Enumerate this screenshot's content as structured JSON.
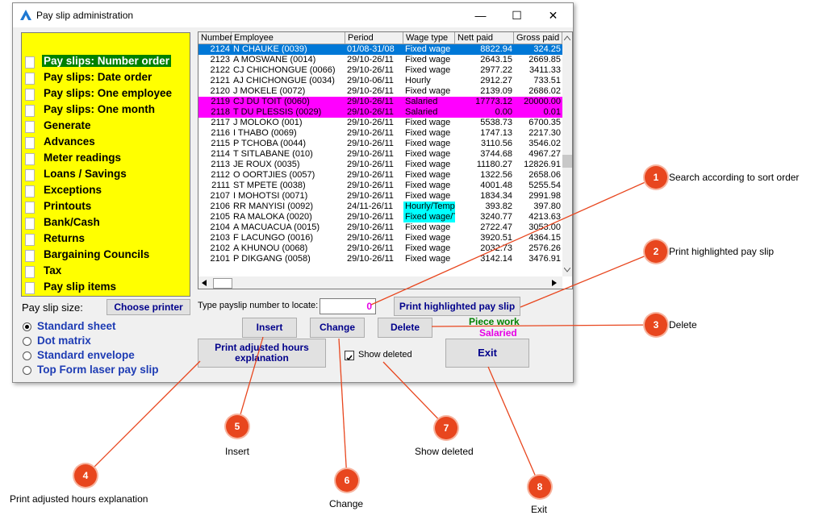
{
  "window": {
    "title": "Pay slip administration",
    "minimize": "—",
    "maximize": "☐",
    "close": "✕"
  },
  "sidebar": {
    "items": [
      {
        "label": "Pay slips: Number order",
        "selected": true
      },
      {
        "label": "Pay slips: Date order"
      },
      {
        "label": "Pay slips: One employee"
      },
      {
        "label": "Pay slips: One month"
      },
      {
        "label": "Generate"
      },
      {
        "label": "Advances"
      },
      {
        "label": "Meter readings"
      },
      {
        "label": "Loans / Savings"
      },
      {
        "label": "Exceptions"
      },
      {
        "label": "Printouts"
      },
      {
        "label": "Bank/Cash"
      },
      {
        "label": "Returns"
      },
      {
        "label": "Bargaining Councils"
      },
      {
        "label": "Tax"
      },
      {
        "label": "Pay slip items"
      }
    ]
  },
  "table": {
    "headers": [
      "Number",
      "Employee",
      "Period",
      "Wage type",
      "Nett paid",
      "Gross paid"
    ],
    "rows": [
      {
        "number": "2124",
        "employee": "N CHAUKE (0039)",
        "period": "01/08-31/08",
        "wage": "Fixed wage",
        "nett": "8822.94",
        "gross": "324.25",
        "style": "selected"
      },
      {
        "number": "2123",
        "employee": "A MOSWANE (0014)",
        "period": "29/10-26/11",
        "wage": "Fixed wage",
        "nett": "2643.15",
        "gross": "2669.85"
      },
      {
        "number": "2122",
        "employee": "CJ CHICHONGUE (0066)",
        "period": "29/10-26/11",
        "wage": "Fixed wage",
        "nett": "2977.22",
        "gross": "3411.33"
      },
      {
        "number": "2121",
        "employee": "AJ CHICHONGUE (0034)",
        "period": "29/10-06/11",
        "wage": "Hourly",
        "nett": "2912.27",
        "gross": "733.51"
      },
      {
        "number": "2120",
        "employee": "J MOKELE (0072)",
        "period": "29/10-26/11",
        "wage": "Fixed wage",
        "nett": "2139.09",
        "gross": "2686.02"
      },
      {
        "number": "2119",
        "employee": "CJ DU TOIT (0060)",
        "period": "29/10-26/11",
        "wage": "Salaried",
        "nett": "17773.12",
        "gross": "20000.00",
        "style": "magenta"
      },
      {
        "number": "2118",
        "employee": "T DU PLESSIS (0029)",
        "period": "29/10-26/11",
        "wage": "Salaried",
        "nett": "0.00",
        "gross": "0.01",
        "style": "magenta"
      },
      {
        "number": "2117",
        "employee": "J MOLOKO (001)",
        "period": "29/10-26/11",
        "wage": "Fixed wage",
        "nett": "5538.73",
        "gross": "6700.35"
      },
      {
        "number": "2116",
        "employee": "I THABO (0069)",
        "period": "29/10-26/11",
        "wage": "Fixed wage",
        "nett": "1747.13",
        "gross": "2217.30"
      },
      {
        "number": "2115",
        "employee": "P TCHOBA (0044)",
        "period": "29/10-26/11",
        "wage": "Fixed wage",
        "nett": "3110.56",
        "gross": "3546.02"
      },
      {
        "number": "2114",
        "employee": "T SITLABANE (010)",
        "period": "29/10-26/11",
        "wage": "Fixed wage",
        "nett": "3744.68",
        "gross": "4967.27"
      },
      {
        "number": "2113",
        "employee": "JE ROUX (0035)",
        "period": "29/10-26/11",
        "wage": "Fixed wage",
        "nett": "11180.27",
        "gross": "12826.91"
      },
      {
        "number": "2112",
        "employee": "O OORTJIES (0057)",
        "period": "29/10-26/11",
        "wage": "Fixed wage",
        "nett": "1322.56",
        "gross": "2658.06"
      },
      {
        "number": "2111",
        "employee": "ST MPETE (0038)",
        "period": "29/10-26/11",
        "wage": "Fixed wage",
        "nett": "4001.48",
        "gross": "5255.54"
      },
      {
        "number": "2107",
        "employee": "I MOHOTSI (0071)",
        "period": "29/10-26/11",
        "wage": "Fixed wage",
        "nett": "1834.34",
        "gross": "2991.98"
      },
      {
        "number": "2106",
        "employee": "RR MANYISI (0092)",
        "period": "24/11-26/11",
        "wage": "Hourly/Temp",
        "nett": "393.82",
        "gross": "397.80",
        "style": "cyan"
      },
      {
        "number": "2105",
        "employee": "RA MALOKA (0020)",
        "period": "29/10-26/11",
        "wage": "Fixed wage/T",
        "nett": "3240.77",
        "gross": "4213.63",
        "style": "cyan"
      },
      {
        "number": "2104",
        "employee": "A MACUACUA (0015)",
        "period": "29/10-26/11",
        "wage": "Fixed wage",
        "nett": "2722.47",
        "gross": "3053.00"
      },
      {
        "number": "2103",
        "employee": "F LACUNGO (0016)",
        "period": "29/10-26/11",
        "wage": "Fixed wage",
        "nett": "3920.51",
        "gross": "4364.15"
      },
      {
        "number": "2102",
        "employee": "A KHUNOU (0068)",
        "period": "29/10-26/11",
        "wage": "Fixed wage",
        "nett": "2032.73",
        "gross": "2576.26"
      },
      {
        "number": "2101",
        "employee": "P DIKGANG (0058)",
        "period": "29/10-26/11",
        "wage": "Fixed wage",
        "nett": "3142.14",
        "gross": "3476.91"
      }
    ]
  },
  "controls": {
    "payslip_size_label": "Pay slip size:",
    "choose_printer": "Choose printer",
    "locate_label": "Type payslip number to locate:",
    "locate_value": "0",
    "print_highlighted": "Print highlighted pay slip",
    "insert": "Insert",
    "change": "Change",
    "delete": "Delete",
    "print_adjusted": "Print adjusted hours explanation",
    "show_deleted": "Show deleted",
    "exit": "Exit",
    "legend_piece": "Piece work",
    "legend_salaried": "Salaried"
  },
  "sizes": [
    {
      "label": "Standard sheet",
      "checked": true
    },
    {
      "label": "Dot matrix"
    },
    {
      "label": "Standard envelope"
    },
    {
      "label": "Top Form laser pay slip"
    }
  ],
  "callouts": [
    {
      "n": "1",
      "text": "Search according to sort order"
    },
    {
      "n": "2",
      "text": "Print highlighted pay slip"
    },
    {
      "n": "3",
      "text": "Delete"
    },
    {
      "n": "4",
      "text": "Print adjusted hours explanation"
    },
    {
      "n": "5",
      "text": "Insert"
    },
    {
      "n": "6",
      "text": "Change"
    },
    {
      "n": "7",
      "text": "Show deleted"
    },
    {
      "n": "8",
      "text": "Exit"
    }
  ],
  "colors": {
    "selected": "#0078d7",
    "magenta": "#ff00ff",
    "cyan": "#00ffff",
    "sidebar": "#ffff00",
    "callout": "#e8461e",
    "piece": "#008000",
    "salaried": "#e600e6"
  }
}
